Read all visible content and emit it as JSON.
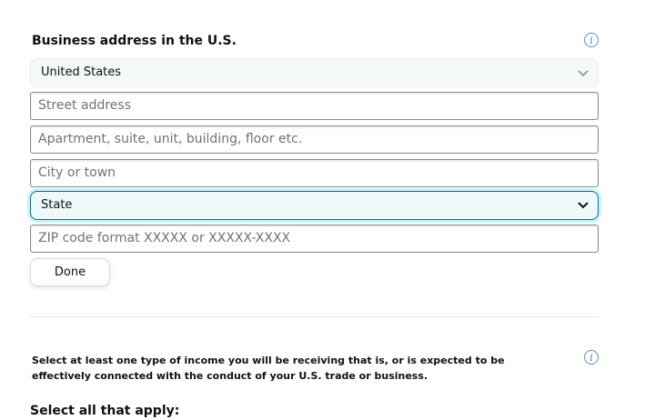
{
  "address": {
    "title": "Business address in the U.S.",
    "info_icon": "info-icon",
    "country_value": "United States",
    "street_placeholder": "Street address",
    "apartment_placeholder": "Apartment, suite, unit, building, floor etc.",
    "city_placeholder": "City or town",
    "state_value": "State",
    "zip_placeholder": "ZIP code format XXXXX or XXXXX-XXXX",
    "done_label": "Done"
  },
  "income": {
    "instruction": "Select at least one type of income you will be receiving that is, or is expected to be effectively connected with the conduct of your U.S. trade or business.",
    "info_icon": "info-icon",
    "apply_label": "Select all that apply:"
  },
  "colors": {
    "focus_border": "#007185",
    "info_blue": "#4a7fb4"
  }
}
